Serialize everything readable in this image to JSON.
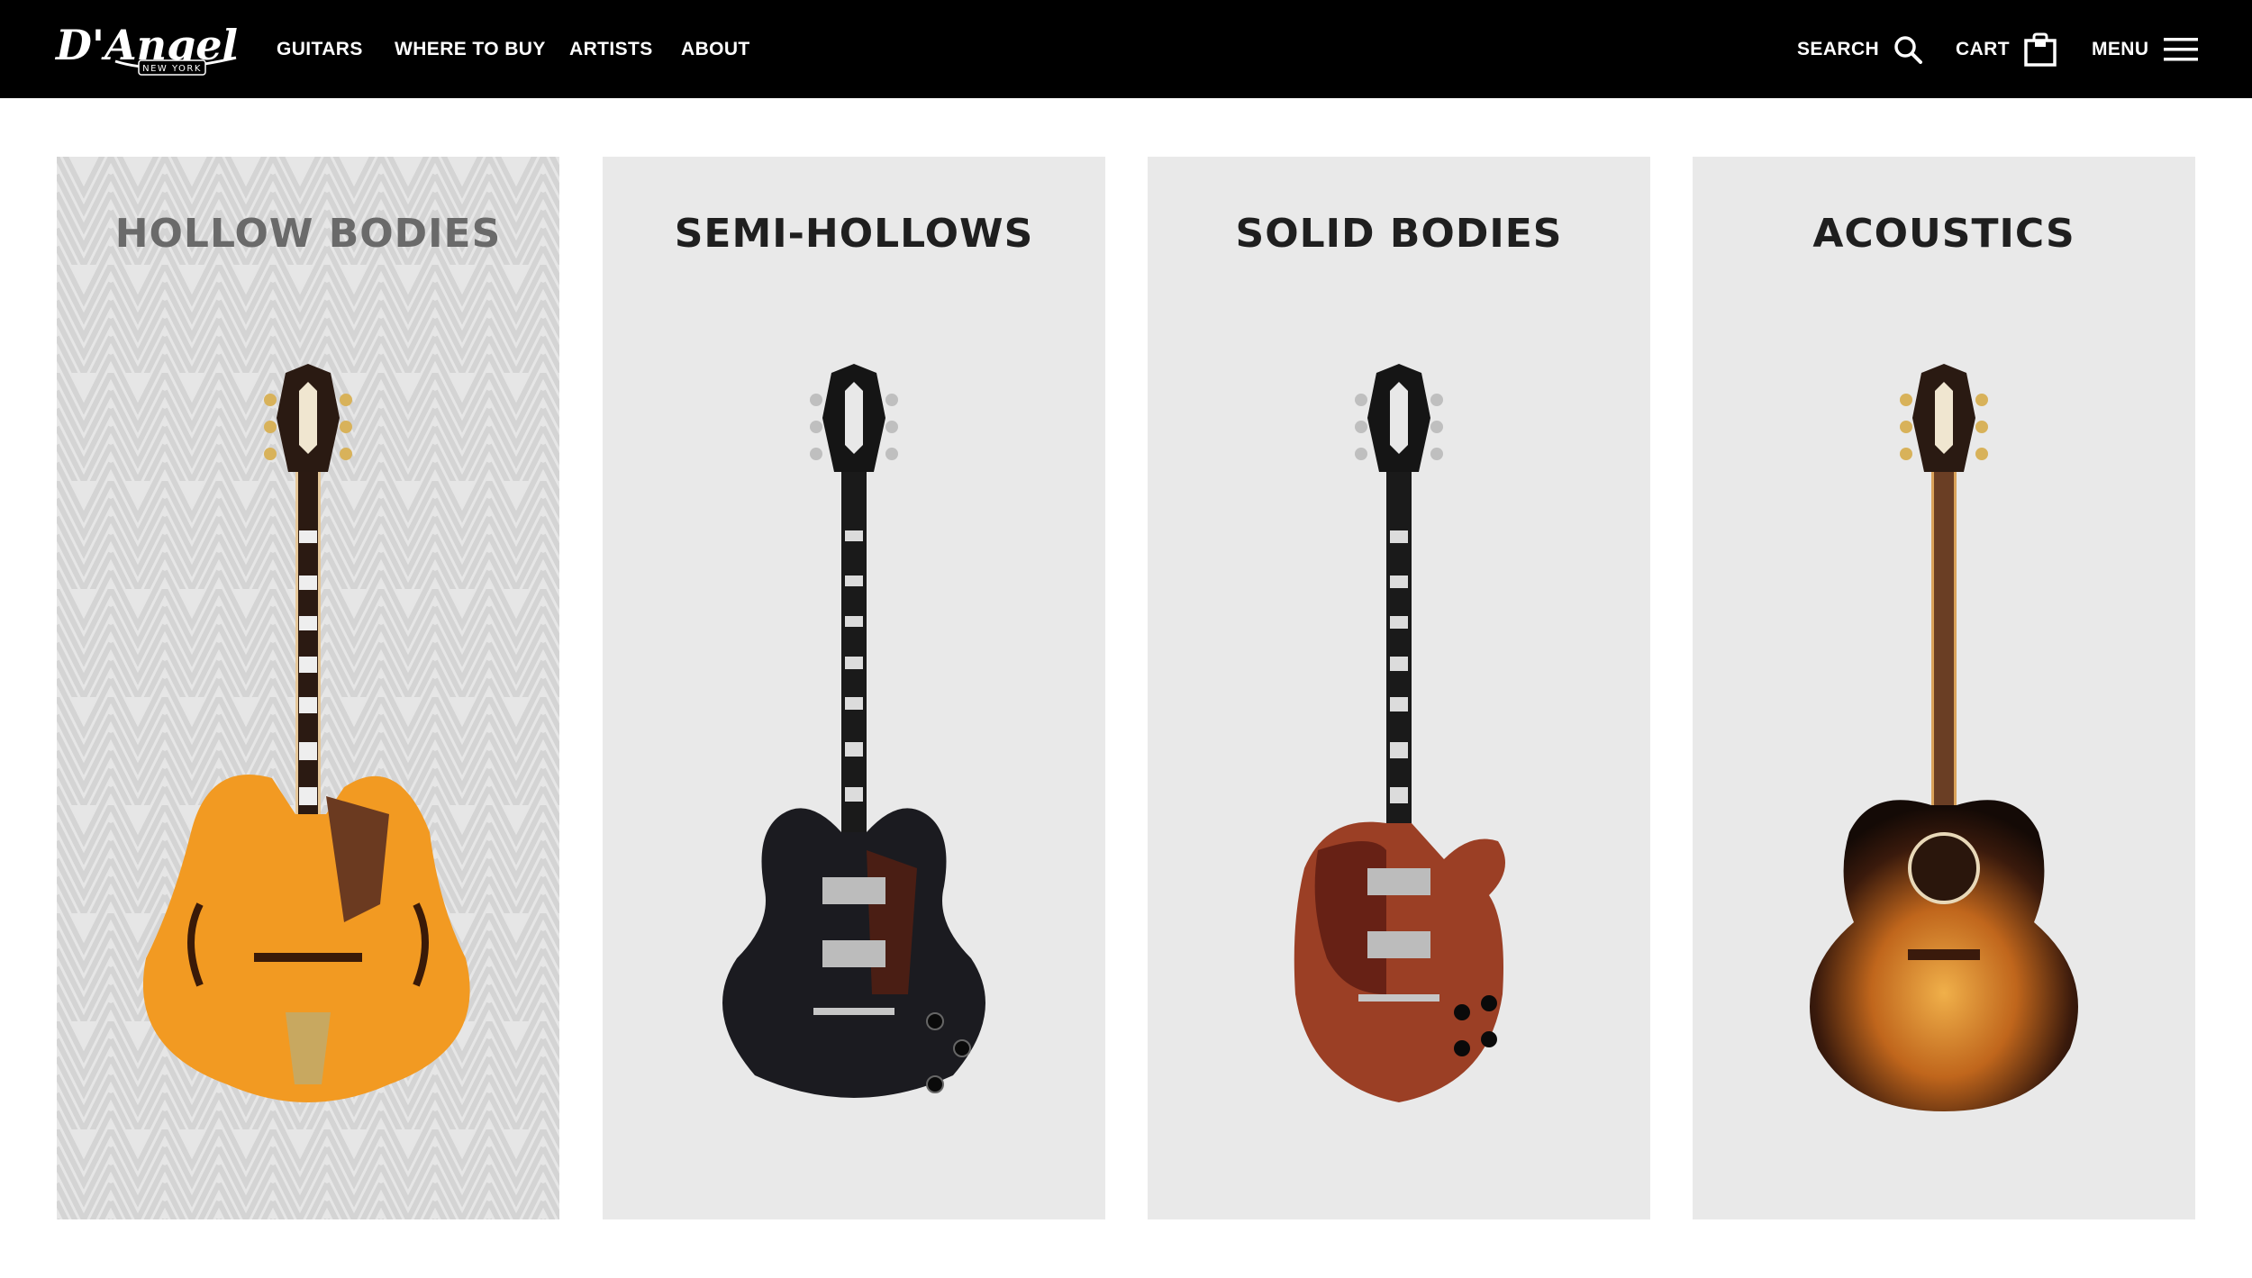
{
  "header": {
    "logo_text": "D'Angelico",
    "logo_sub": "NEW YORK",
    "nav": [
      {
        "label": "GUITARS"
      },
      {
        "label": "WHERE TO BUY"
      },
      {
        "label": "ARTISTS"
      },
      {
        "label": "ABOUT"
      }
    ],
    "search_label": "SEARCH",
    "cart_label": "CART",
    "menu_label": "MENU"
  },
  "categories": [
    {
      "title": "HOLLOW BODIES",
      "guitar": "hollow-body-guitar-image",
      "state": "hovered"
    },
    {
      "title": "SEMI-HOLLOWS",
      "guitar": "semi-hollow-guitar-image"
    },
    {
      "title": "SOLID BODIES",
      "guitar": "solid-body-guitar-image"
    },
    {
      "title": "ACOUSTICS",
      "guitar": "acoustic-guitar-image"
    }
  ],
  "colors": {
    "header_bg": "#000000",
    "card_bg": "#e9e9e9",
    "title_text": "#1f1f1f",
    "hover_title_text": "#6a6a6a"
  }
}
